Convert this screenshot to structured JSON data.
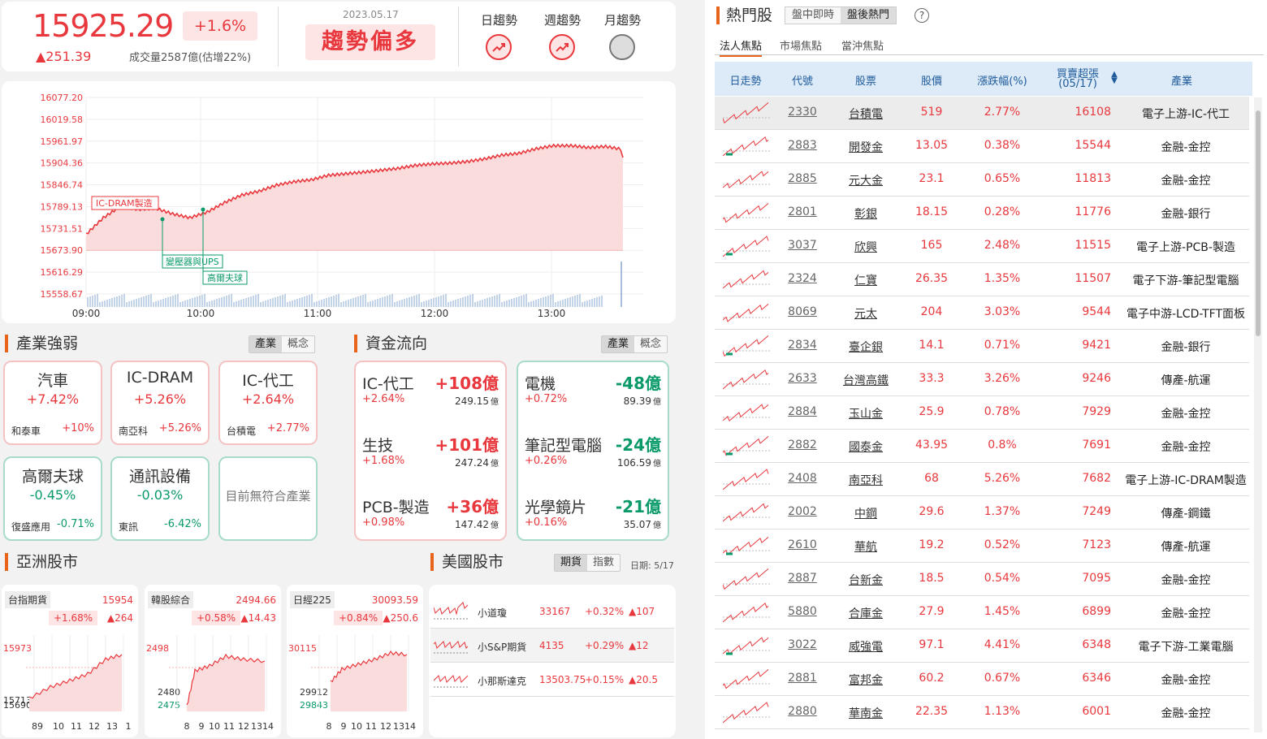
{
  "header": {
    "index": "15925.29",
    "pct": "+1.6%",
    "change": "▲251.39",
    "volume": "成交量2587億(估增22%)",
    "date": "2023.05.17",
    "trend": "趨勢偏多",
    "day_label": "日趨勢",
    "week_label": "週趨勢",
    "month_label": "月趨勢"
  },
  "main_chart": {
    "y_ticks": [
      "16077.20",
      "16019.58",
      "15961.97",
      "15904.36",
      "15846.74",
      "15789.13",
      "15731.51",
      "15673.90",
      "15616.29",
      "15558.67"
    ],
    "x_ticks": [
      "09:00",
      "10:00",
      "11:00",
      "12:00",
      "13:00"
    ],
    "ylim": [
      15558.67,
      16077.2
    ],
    "open": 15673.9,
    "ann1": "IC-DRAM製造",
    "ann2": "變壓器與UPS",
    "ann3": "高爾夫球",
    "series": [
      15716,
      15760,
      15790,
      15782,
      15785,
      15770,
      15760,
      15775,
      15800,
      15820,
      15830,
      15846,
      15855,
      15860,
      15872,
      15876,
      15880,
      15885,
      15890,
      15898,
      15902,
      15904,
      15908,
      15915,
      15925,
      15930,
      15942,
      15950,
      15950,
      15945,
      15948,
      15940
    ]
  },
  "industry": {
    "title": "產業強弱",
    "tog1": "產業",
    "tog2": "概念",
    "boxes": [
      {
        "name": "汽車",
        "pct": "+7.42%",
        "stock": "和泰車",
        "spct": "+10%"
      },
      {
        "name": "IC-DRAM",
        "pct": "+5.26%",
        "stock": "南亞科",
        "spct": "+5.26%"
      },
      {
        "name": "IC-代工",
        "pct": "+2.64%",
        "stock": "台積電",
        "spct": "+2.77%"
      },
      {
        "name": "高爾夫球",
        "pct": "-0.45%",
        "stock": "復盛應用",
        "spct": "-0.71%"
      },
      {
        "name": "通訊設備",
        "pct": "-0.03%",
        "stock": "東訊",
        "spct": "-6.42%"
      }
    ],
    "nomatch": "目前無符合產業"
  },
  "fund": {
    "title": "資金流向",
    "tog1": "產業",
    "tog2": "概念",
    "unit": "億",
    "inflow": [
      {
        "name": "IC-代工",
        "val": "+108億",
        "pct": "+2.64%",
        "amt": "249.15"
      },
      {
        "name": "生技",
        "val": "+101億",
        "pct": "+1.68%",
        "amt": "247.24"
      },
      {
        "name": "PCB-製造",
        "val": "+36億",
        "pct": "+0.98%",
        "amt": "147.42"
      }
    ],
    "outflow": [
      {
        "name": "電機",
        "val": "-48億",
        "pct": "+0.72%",
        "amt": "89.39"
      },
      {
        "name": "筆記型電腦",
        "val": "-24億",
        "pct": "+0.26%",
        "amt": "106.59"
      },
      {
        "name": "光學鏡片",
        "val": "-21億",
        "pct": "+0.16%",
        "amt": "35.07"
      }
    ]
  },
  "asia": {
    "title": "亞洲股市",
    "markets": [
      {
        "name": "台指期貨",
        "value": "15954",
        "pct": "+1.68%",
        "chg": "▲264",
        "y1": "15973",
        "y2": "15713",
        "y3": "15690",
        "x": [
          "89",
          "10",
          "11",
          "12",
          "13",
          "1"
        ]
      },
      {
        "name": "韓股綜合",
        "value": "2494.66",
        "pct": "+0.58%",
        "chg": "▲14.43",
        "y1": "2498",
        "y2": "2480",
        "y3": "2475",
        "x": [
          "8",
          "9",
          "10",
          "11",
          "12",
          "13",
          "14"
        ]
      },
      {
        "name": "日經225",
        "value": "30093.59",
        "pct": "+0.84%",
        "chg": "▲250.6",
        "y1": "30115",
        "y2": "29912",
        "y3": "29843",
        "x": [
          "8",
          "9",
          "10",
          "11",
          "12",
          "13",
          "14"
        ]
      }
    ]
  },
  "us": {
    "title": "美國股市",
    "tog1": "期貨",
    "tog2": "指數",
    "date": "日期: 5/17",
    "rows": [
      {
        "name": "小道瓊",
        "value": "33167",
        "pct": "+0.32%",
        "chg": "▲107"
      },
      {
        "name": "小S&P期貨",
        "value": "4135",
        "pct": "+0.29%",
        "chg": "▲12"
      },
      {
        "name": "小那斯達克",
        "value": "13503.75",
        "pct": "+0.15%",
        "chg": "▲20.5"
      }
    ]
  },
  "hot": {
    "title": "熱門股",
    "tab1": "盤中即時",
    "tab2": "盤後熱門",
    "help": "?",
    "sub1": "法人焦點",
    "sub2": "市場焦點",
    "sub3": "當沖焦點",
    "cols": {
      "trend": "日走勢",
      "code": "代號",
      "stock": "股票",
      "price": "股價",
      "pct": "漲跌幅(%)",
      "buy": "買賣超張",
      "buy_date": "(05/17)",
      "ind": "產業"
    },
    "rows": [
      {
        "code": "2330",
        "name": "台積電",
        "price": "519",
        "pct": "2.77%",
        "buy": "16108",
        "ind": "電子上游-IC-代工"
      },
      {
        "code": "2883",
        "name": "開發金",
        "price": "13.05",
        "pct": "0.38%",
        "buy": "15544",
        "ind": "金融-金控"
      },
      {
        "code": "2885",
        "name": "元大金",
        "price": "23.1",
        "pct": "0.65%",
        "buy": "11813",
        "ind": "金融-金控"
      },
      {
        "code": "2801",
        "name": "彰銀",
        "price": "18.15",
        "pct": "0.28%",
        "buy": "11776",
        "ind": "金融-銀行"
      },
      {
        "code": "3037",
        "name": "欣興",
        "price": "165",
        "pct": "2.48%",
        "buy": "11515",
        "ind": "電子上游-PCB-製造"
      },
      {
        "code": "2324",
        "name": "仁寶",
        "price": "26.35",
        "pct": "1.35%",
        "buy": "11507",
        "ind": "電子下游-筆記型電腦"
      },
      {
        "code": "8069",
        "name": "元太",
        "price": "204",
        "pct": "3.03%",
        "buy": "9544",
        "ind": "電子中游-LCD-TFT面板"
      },
      {
        "code": "2834",
        "name": "臺企銀",
        "price": "14.1",
        "pct": "0.71%",
        "buy": "9421",
        "ind": "金融-銀行"
      },
      {
        "code": "2633",
        "name": "台灣高鐵",
        "price": "33.3",
        "pct": "3.26%",
        "buy": "9246",
        "ind": "傳產-航運"
      },
      {
        "code": "2884",
        "name": "玉山金",
        "price": "25.9",
        "pct": "0.78%",
        "buy": "7929",
        "ind": "金融-金控"
      },
      {
        "code": "2882",
        "name": "國泰金",
        "price": "43.95",
        "pct": "0.8%",
        "buy": "7691",
        "ind": "金融-金控"
      },
      {
        "code": "2408",
        "name": "南亞科",
        "price": "68",
        "pct": "5.26%",
        "buy": "7682",
        "ind": "電子上游-IC-DRAM製造"
      },
      {
        "code": "2002",
        "name": "中鋼",
        "price": "29.6",
        "pct": "1.37%",
        "buy": "7249",
        "ind": "傳產-鋼鐵"
      },
      {
        "code": "2610",
        "name": "華航",
        "price": "19.2",
        "pct": "0.52%",
        "buy": "7123",
        "ind": "傳產-航運"
      },
      {
        "code": "2887",
        "name": "台新金",
        "price": "18.5",
        "pct": "0.54%",
        "buy": "7095",
        "ind": "金融-金控"
      },
      {
        "code": "5880",
        "name": "合庫金",
        "price": "27.9",
        "pct": "1.45%",
        "buy": "6899",
        "ind": "金融-金控"
      },
      {
        "code": "3022",
        "name": "威強電",
        "price": "97.1",
        "pct": "4.41%",
        "buy": "6348",
        "ind": "電子下游-工業電腦"
      },
      {
        "code": "2881",
        "name": "富邦金",
        "price": "60.2",
        "pct": "0.67%",
        "buy": "6346",
        "ind": "金融-金控"
      },
      {
        "code": "2880",
        "name": "華南金",
        "price": "22.35",
        "pct": "1.13%",
        "buy": "6001",
        "ind": "金融-金控"
      }
    ]
  }
}
